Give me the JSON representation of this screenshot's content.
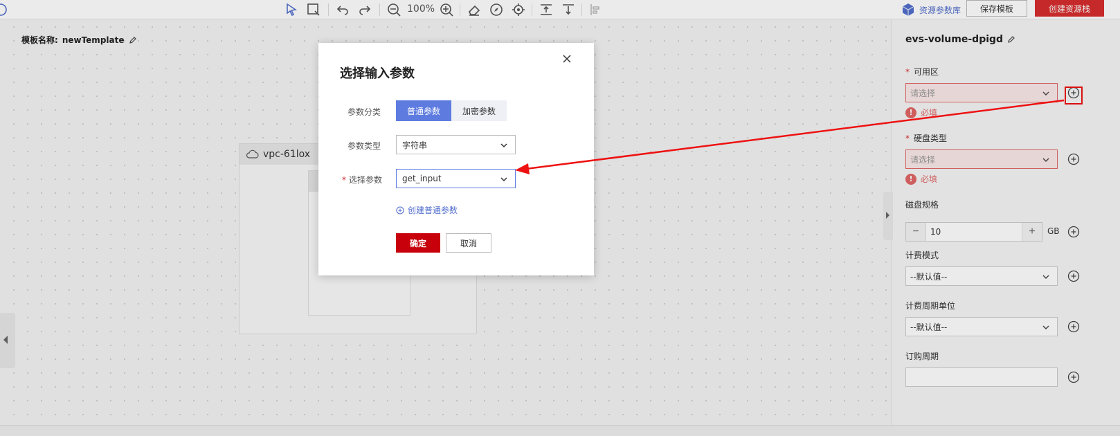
{
  "toolbar": {
    "zoom": "100%",
    "resource_library": "资源参数库",
    "save_template": "保存模板",
    "create_stack": "创建资源栈"
  },
  "canvas": {
    "template_label": "模板名称:",
    "template_name": "newTemplate",
    "vpc_name": "vpc-61lox"
  },
  "modal": {
    "title": "选择输入参数",
    "category_label": "参数分类",
    "category_options": [
      "普通参数",
      "加密参数"
    ],
    "type_label": "参数类型",
    "type_value": "字符串",
    "param_label": "选择参数",
    "param_value": "get_input",
    "create_link": "创建普通参数",
    "ok": "确定",
    "cancel": "取消"
  },
  "panel": {
    "title": "evs-volume-dpigd",
    "az_label": "可用区",
    "az_placeholder": "请选择",
    "required_msg": "必填",
    "disk_type_label": "硬盘类型",
    "disk_type_placeholder": "请选择",
    "disk_size_label": "磁盘规格",
    "disk_size_value": "10",
    "disk_size_unit": "GB",
    "billing_mode_label": "计费模式",
    "billing_mode_value": "--默认值--",
    "period_unit_label": "计费周期单位",
    "period_unit_value": "--默认值--",
    "period_label": "订购周期"
  },
  "colors": {
    "accent": "#5e7ce0",
    "danger": "#c7000b",
    "error": "#e16767",
    "annotation": "#ee1111"
  }
}
